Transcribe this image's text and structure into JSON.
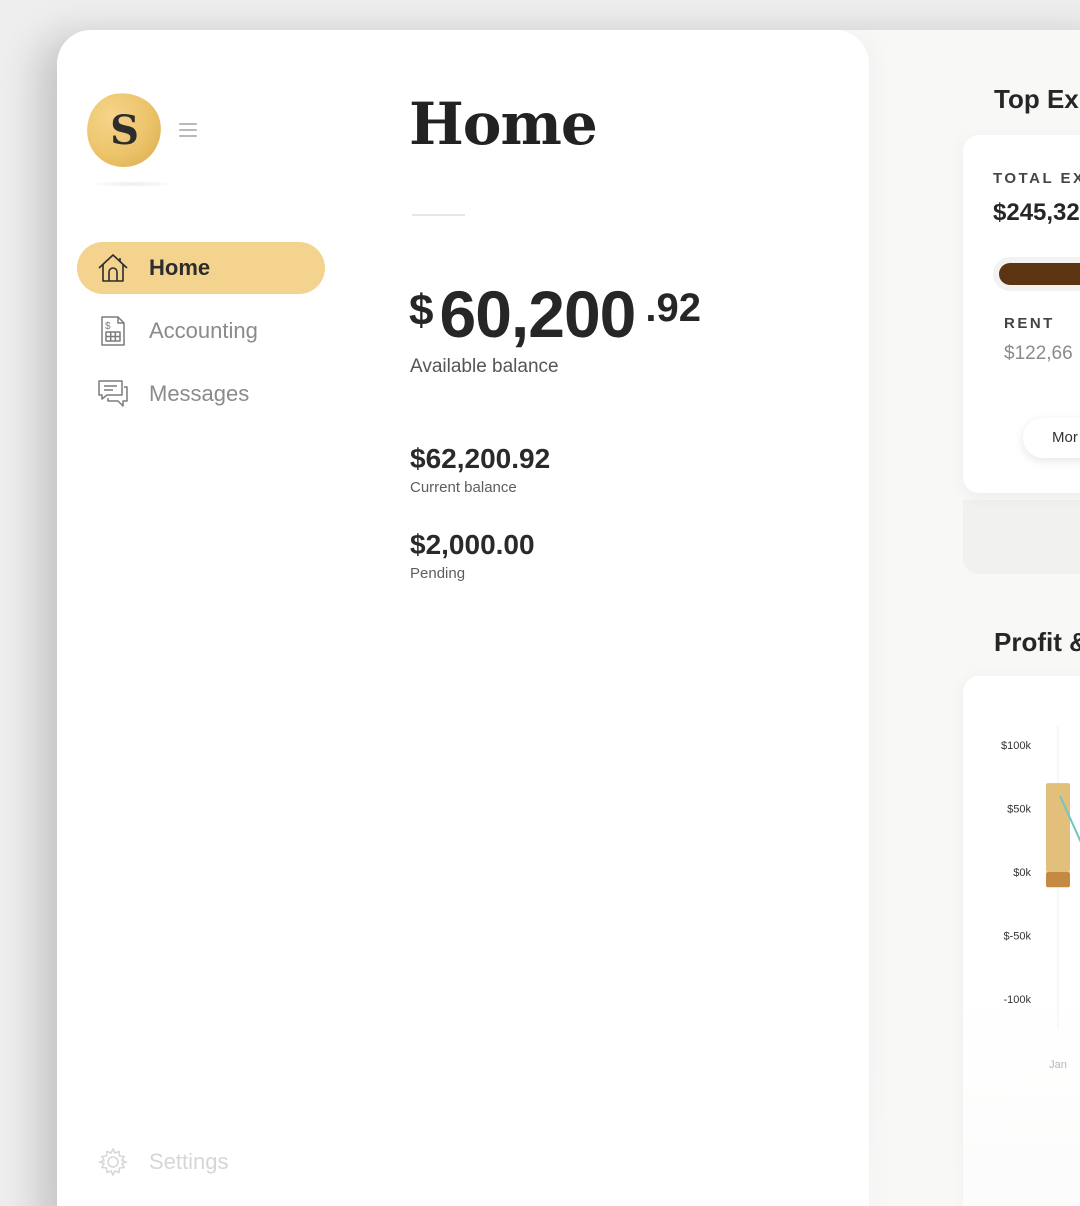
{
  "brand": {
    "logo_letter": "S"
  },
  "nav": {
    "items": [
      {
        "label": "Home",
        "icon": "home-icon",
        "active": true
      },
      {
        "label": "Accounting",
        "icon": "invoice-icon",
        "active": false
      },
      {
        "label": "Messages",
        "icon": "chat-icon",
        "active": false
      }
    ],
    "settings_label": "Settings"
  },
  "main": {
    "title": "Home",
    "available_balance": {
      "currency": "$",
      "whole": "60,200",
      "cents": ".92",
      "label": "Available balance"
    },
    "current_balance": {
      "amount": "$62,200.92",
      "label": "Current balance"
    },
    "pending": {
      "amount": "$2,000.00",
      "label": "Pending"
    }
  },
  "top_expenses": {
    "title": "Top Exp",
    "total_label": "TOTAL EX",
    "total_value": "$245,32",
    "category_label": "RENT",
    "category_value": "$122,66",
    "more_button": "Mor",
    "rent_share": 0.5
  },
  "profit": {
    "title": "Profit &"
  },
  "chart_data": {
    "type": "bar",
    "categories": [
      "Jan"
    ],
    "y_ticks": [
      "$100k",
      "$50k",
      "$0k",
      "$-50k",
      "-100k"
    ],
    "ylim": [
      -100000,
      100000
    ],
    "series": [
      {
        "values": [
          70000
        ]
      },
      {
        "values": [
          -12000
        ]
      }
    ],
    "line_series": [
      {
        "values": [
          60000
        ]
      }
    ]
  },
  "colors": {
    "accent": "#f3d38e",
    "bar_primary": "#e2bf7a",
    "bar_secondary": "#c48a44",
    "expense_bar": "#5c3412",
    "line": "#6fc8c0"
  }
}
